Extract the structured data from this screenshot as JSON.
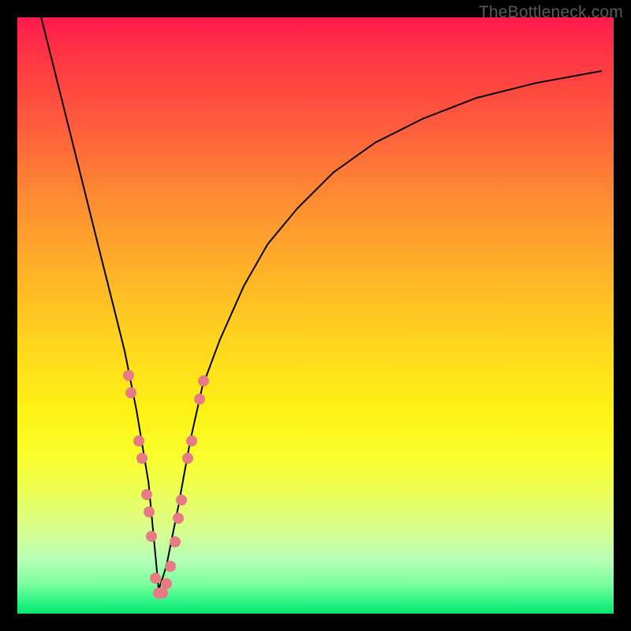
{
  "watermark": "TheBottleneck.com",
  "chart_data": {
    "type": "line",
    "title": "",
    "xlabel": "",
    "ylabel": "",
    "xlim": [
      0,
      100
    ],
    "ylim": [
      0,
      100
    ],
    "series": [
      {
        "name": "curve",
        "x": [
          4,
          6,
          8,
          10,
          12,
          14,
          16,
          18,
          20,
          22,
          23.7,
          25,
          27,
          29,
          31,
          34,
          38,
          42,
          47,
          53,
          60,
          68,
          77,
          87,
          98
        ],
        "values": [
          100,
          92,
          84,
          76,
          68,
          60,
          52,
          44,
          34,
          22,
          4,
          8,
          18,
          29,
          38,
          46,
          55,
          62,
          68,
          74,
          79,
          83,
          86.5,
          89,
          91
        ]
      }
    ],
    "scatter": {
      "name": "markers",
      "color": "#e77b85",
      "points": [
        {
          "x": 18.7,
          "y": 40
        },
        {
          "x": 19.1,
          "y": 37
        },
        {
          "x": 20.4,
          "y": 29
        },
        {
          "x": 20.9,
          "y": 26
        },
        {
          "x": 21.7,
          "y": 20
        },
        {
          "x": 22.1,
          "y": 17
        },
        {
          "x": 22.5,
          "y": 13
        },
        {
          "x": 23.2,
          "y": 6
        },
        {
          "x": 23.7,
          "y": 3.5
        },
        {
          "x": 24.3,
          "y": 3.5
        },
        {
          "x": 25.0,
          "y": 5
        },
        {
          "x": 25.7,
          "y": 8
        },
        {
          "x": 26.4,
          "y": 12
        },
        {
          "x": 27.0,
          "y": 16
        },
        {
          "x": 27.5,
          "y": 19
        },
        {
          "x": 28.6,
          "y": 26
        },
        {
          "x": 29.2,
          "y": 29
        },
        {
          "x": 30.6,
          "y": 36
        },
        {
          "x": 31.2,
          "y": 39
        }
      ]
    },
    "gradient_stops": [
      {
        "pos": 0,
        "color": "#ff1a4d"
      },
      {
        "pos": 50,
        "color": "#ffd41f"
      },
      {
        "pos": 80,
        "color": "#ecff5a"
      },
      {
        "pos": 100,
        "color": "#09e66e"
      }
    ]
  }
}
